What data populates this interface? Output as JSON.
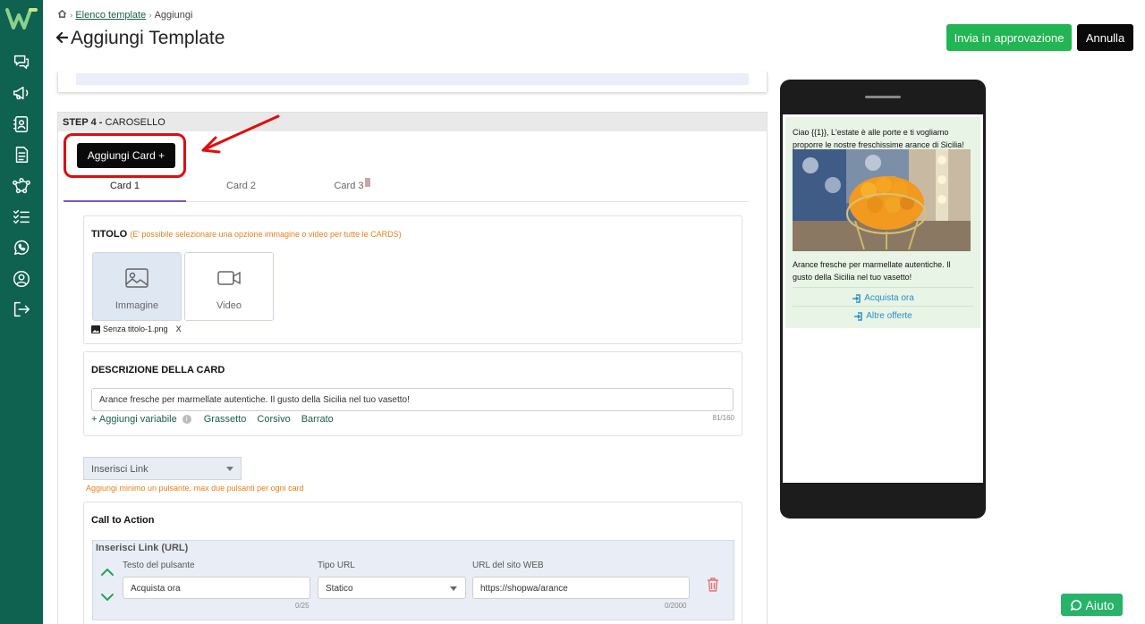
{
  "header": {
    "breadcrumb_link": "Elenco template",
    "breadcrumb_current": "Aggiungi",
    "page_title": "Aggiungi Template",
    "approve_label": "Invia in approvazione",
    "cancel_label": "Annulla"
  },
  "sidebar": {
    "items": [
      "chat-icon",
      "megaphone-icon",
      "contacts-icon",
      "document-icon",
      "flow-icon",
      "checklist-icon",
      "whatsapp-icon",
      "user-icon",
      "logout-icon"
    ]
  },
  "step": {
    "number": "STEP 4 -",
    "name": "CAROSELLO",
    "add_card_label": "Aggiungi Card +",
    "tabs": [
      {
        "label": "Card 1",
        "active": true
      },
      {
        "label": "Card 2",
        "active": false
      },
      {
        "label": "Card 3",
        "active": false
      }
    ]
  },
  "title_section": {
    "heading": "TITOLO",
    "hint": "(E' possibile selezionare una opzione immagine o video per tutte le CARDS)",
    "options": [
      {
        "label": "Immagine",
        "selected": true
      },
      {
        "label": "Video",
        "selected": false
      }
    ],
    "file_name": "Senza titolo-1.png",
    "remove_label": "X"
  },
  "description": {
    "heading": "DESCRIZIONE DELLA CARD",
    "value": "Arance fresche per marmellate autentiche. Il gusto della Sicilia nel tuo vasetto!",
    "counter": "81/160",
    "add_variable": "+ Aggiungi variabile",
    "info": "i",
    "bold": "Grassetto",
    "italic": "Corsivo",
    "strike": "Barrato"
  },
  "link": {
    "select_value": "Inserisci Link",
    "hint": "Aggiungi minimo un pulsante, max due pulsanti per ogni card"
  },
  "cta": {
    "heading": "Call to Action",
    "subheading": "Inserisci Link (URL)",
    "button_text_label": "Testo del pulsante",
    "button_text_value": "Acquista ora",
    "button_text_counter": "0/25",
    "url_type_label": "Tipo URL",
    "url_type_value": "Statico",
    "url_label": "URL del sito WEB",
    "url_value": "https://shopwa/arance",
    "url_counter": "0/2000"
  },
  "preview": {
    "message": "Ciao {{1}}, L'estate è alle porte e ti vogliamo proporre le nostre freschissime arance di Sicilia!",
    "card_description": "Arance fresche per marmellate autentiche. Il gusto della Sicilia nel tuo vasetto!",
    "cta1": "Acquista ora",
    "cta2": "Altre offerte"
  },
  "help": {
    "label": "Aiuto"
  },
  "colors": {
    "sidebar": "#0f6150",
    "primary_green": "#22b553",
    "highlight_red": "#e00d0d",
    "tab_active": "#7e57c2"
  }
}
